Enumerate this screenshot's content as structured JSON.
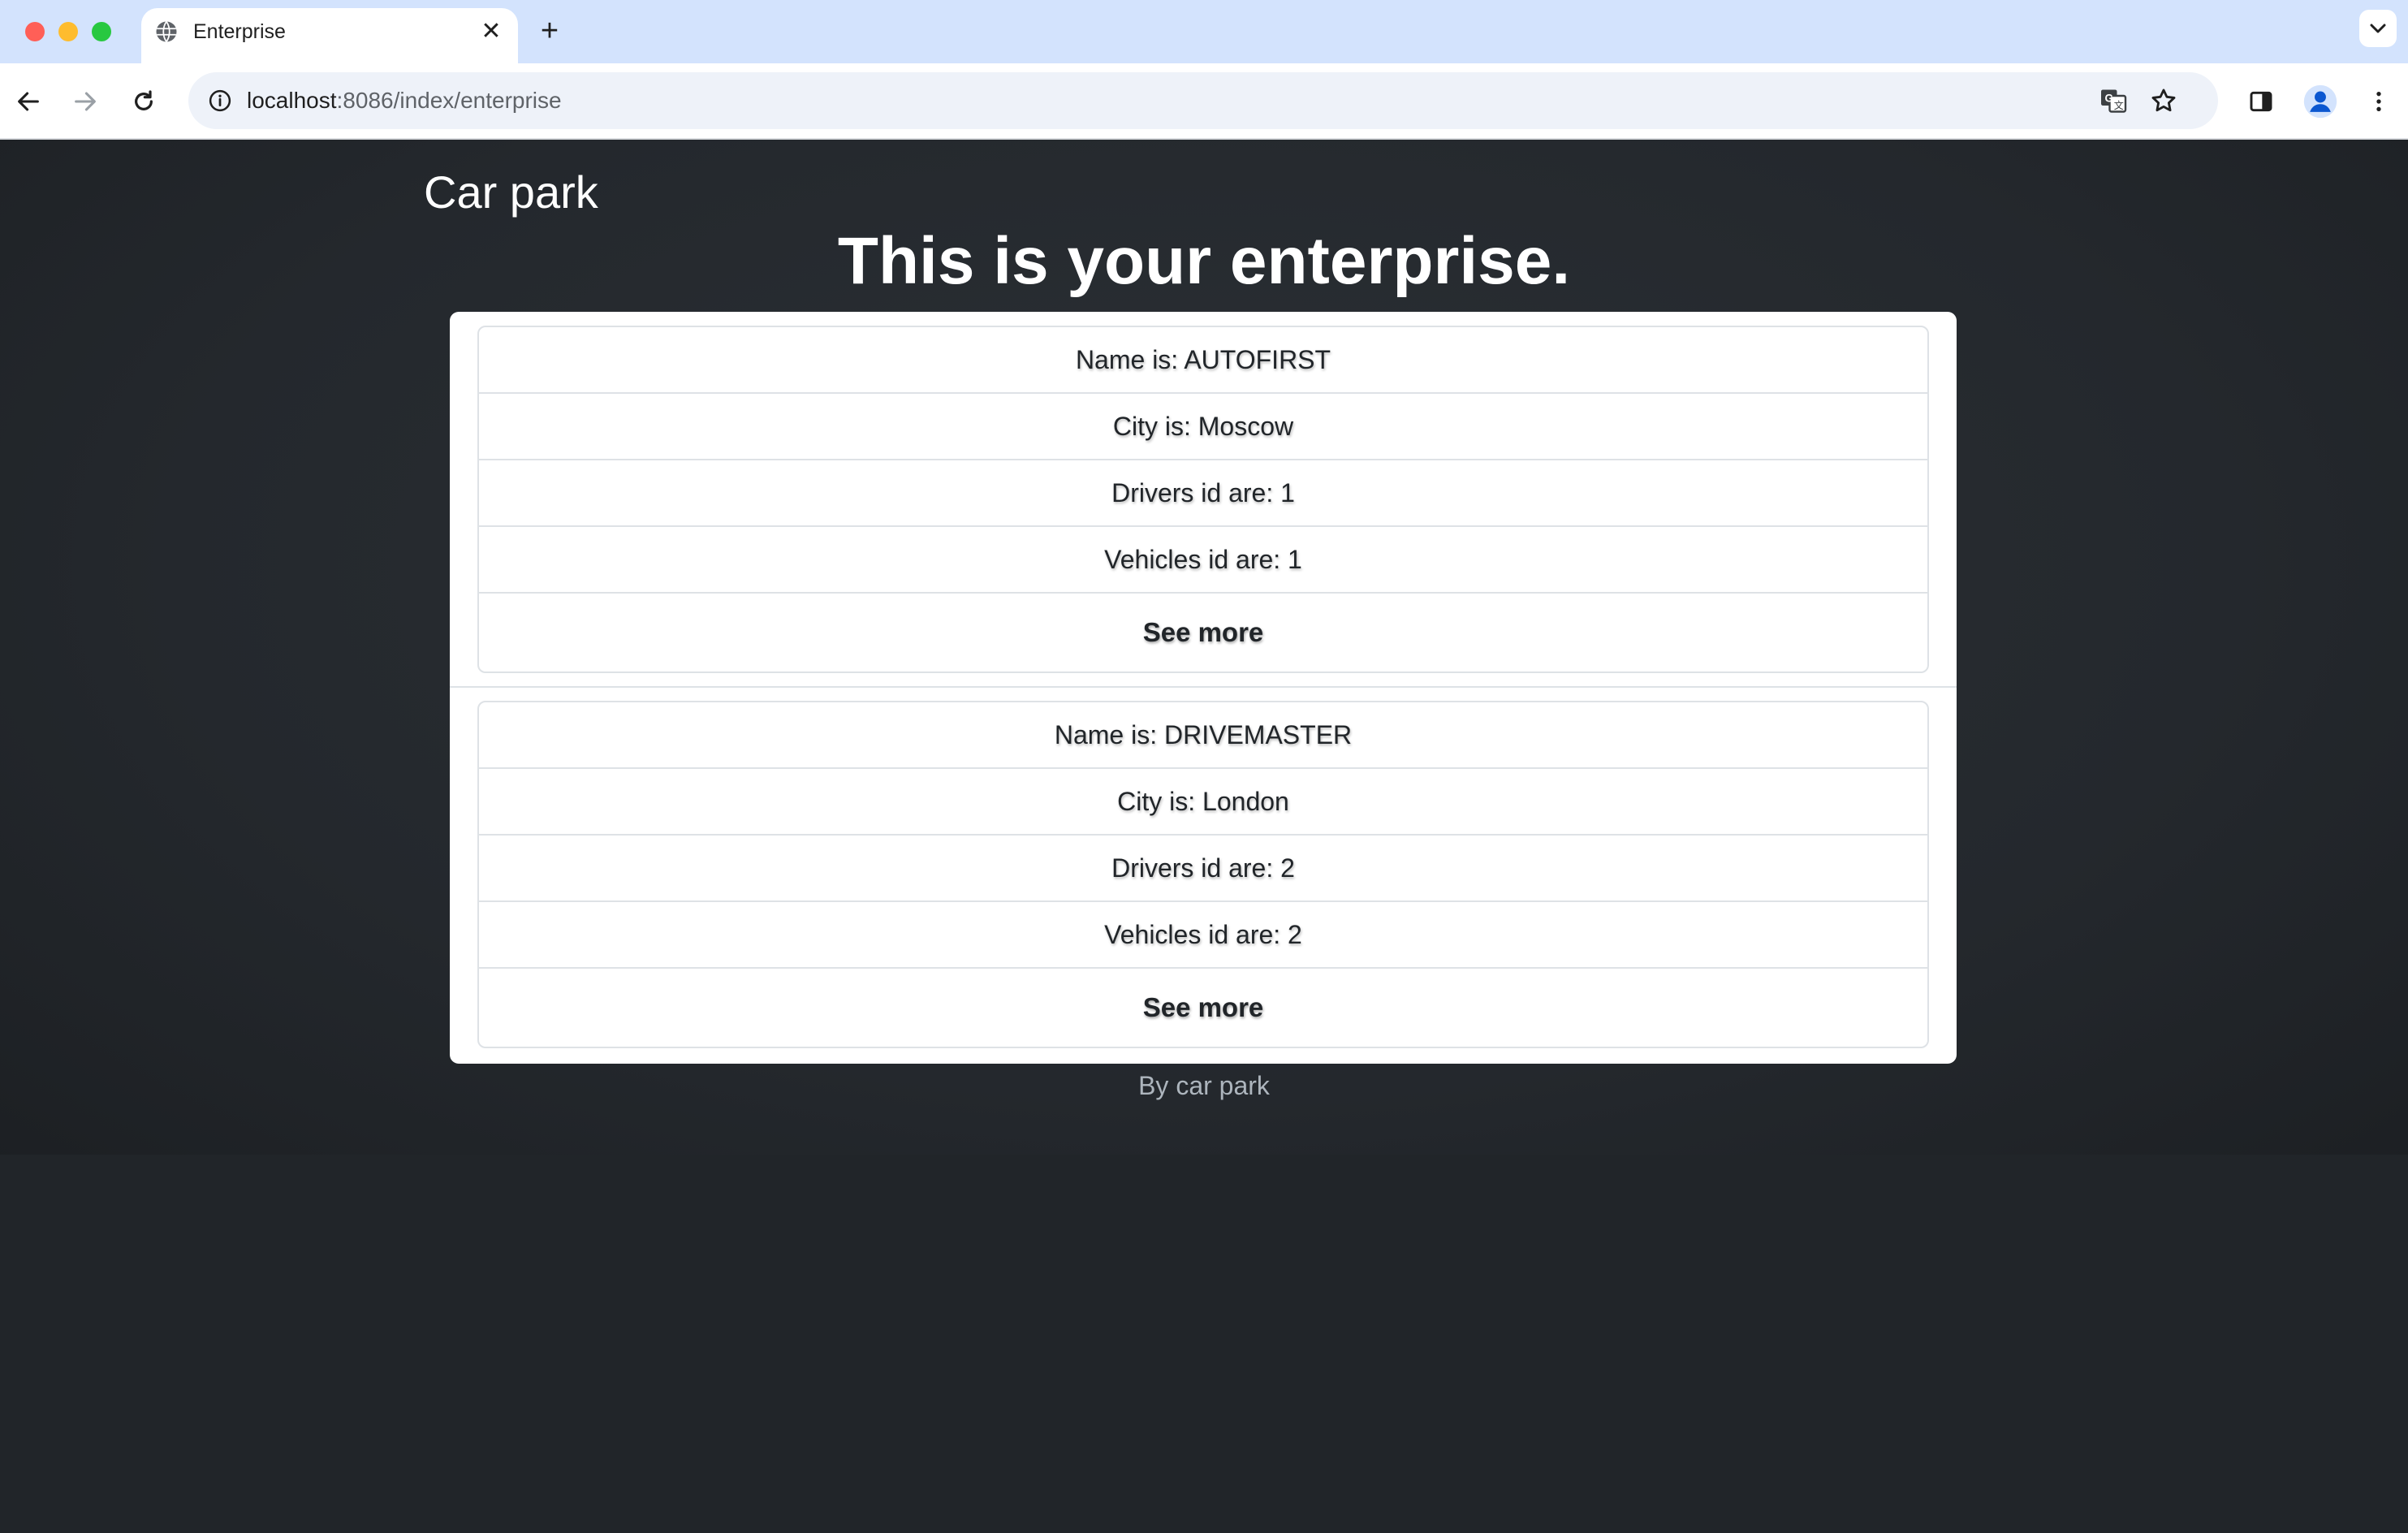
{
  "browser": {
    "tab_title": "Enterprise",
    "new_tab_symbol": "+",
    "close_symbol": "✕",
    "url_host": "localhost",
    "url_path": ":8086/index/enterprise",
    "icons": [
      "globe-icon",
      "back-icon",
      "forward-icon",
      "reload-icon",
      "site-info-icon",
      "translate-icon",
      "star-icon",
      "side-panel-icon",
      "profile-icon",
      "menu-icon",
      "tab-search-icon"
    ]
  },
  "page": {
    "brand": "Car park",
    "headline": "This is your enterprise.",
    "enterprises": [
      {
        "name": "Name is: AUTOFIRST",
        "city": "City is: Moscow",
        "drivers": "Drivers id are: 1",
        "vehicles": "Vehicles id are: 1",
        "more": "See more"
      },
      {
        "name": "Name is: DRIVEMASTER",
        "city": "City is: London",
        "drivers": "Drivers id are: 2",
        "vehicles": "Vehicles id are: 2",
        "more": "See more"
      }
    ],
    "footer": "By car park"
  },
  "colors": {
    "page_bg": "#212529",
    "tabbar_bg": "#d3e3fd",
    "card_border": "#dee2e6",
    "footer_text": "#adb5bd"
  }
}
